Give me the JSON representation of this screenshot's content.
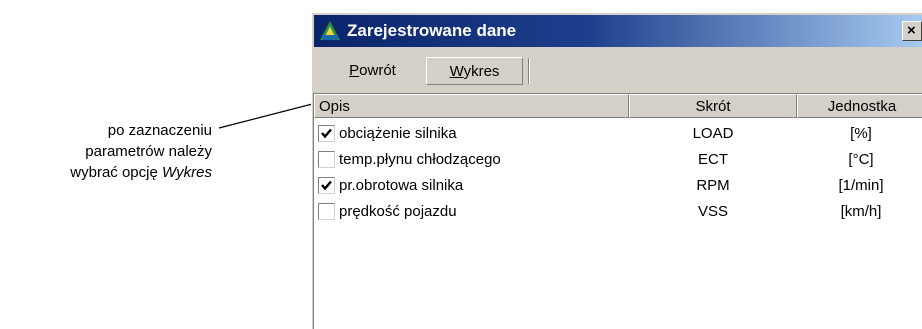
{
  "annotation": {
    "line1": "po zaznaczeniu",
    "line2": "parametrów należy",
    "line3_prefix": "wybrać opcję ",
    "line3_emphasis": "Wykres"
  },
  "window": {
    "title": "Zarejestrowane dane",
    "close_label": "×"
  },
  "toolbar": {
    "powrot_first": "P",
    "powrot_rest": "owrót",
    "wykres_first": "W",
    "wykres_rest": "ykres"
  },
  "table": {
    "columns": [
      "Opis",
      "Skrót",
      "Jednostka"
    ],
    "rows": [
      {
        "checked": true,
        "opis": "obciążenie silnika",
        "skrot": "LOAD",
        "jednostka": "[%]"
      },
      {
        "checked": false,
        "opis": "temp.płynu chłodzącego",
        "skrot": "ECT",
        "jednostka": "[°C]"
      },
      {
        "checked": true,
        "opis": "pr.obrotowa silnika",
        "skrot": "RPM",
        "jednostka": "[1/min]"
      },
      {
        "checked": false,
        "opis": "prędkość pojazdu",
        "skrot": "VSS",
        "jednostka": "[km/h]"
      }
    ]
  },
  "colors": {
    "titlebar_start": "#0a246a",
    "titlebar_end": "#a6caf0",
    "window_bg": "#d4d0c8"
  }
}
